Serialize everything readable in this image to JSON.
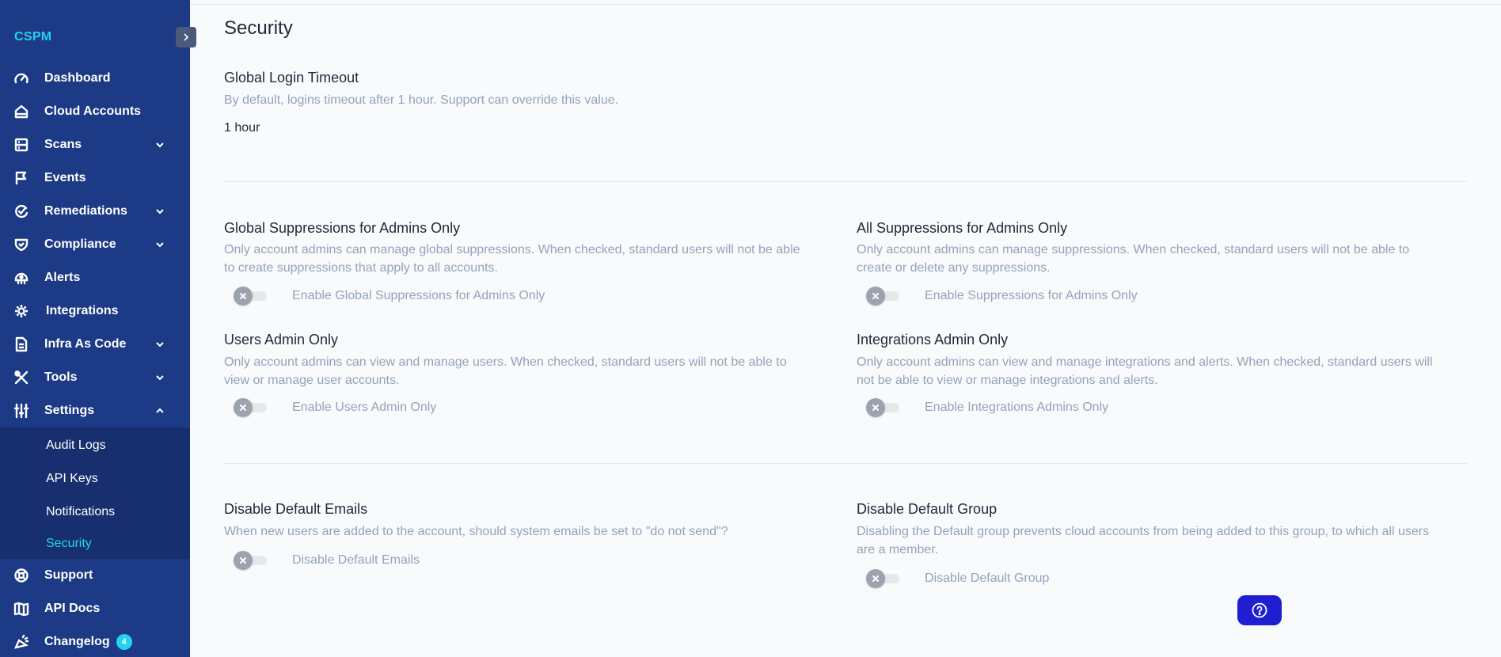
{
  "app": {
    "brand": "CSPM"
  },
  "sidebar": {
    "items": [
      {
        "label": "Dashboard",
        "icon": "gauge-icon"
      },
      {
        "label": "Cloud Accounts",
        "icon": "cloud-account-icon"
      },
      {
        "label": "Scans",
        "icon": "server-icon",
        "expandable": true
      },
      {
        "label": "Events",
        "icon": "flag-icon"
      },
      {
        "label": "Remediations",
        "icon": "remediation-icon",
        "expandable": true
      },
      {
        "label": "Compliance",
        "icon": "shield-check-icon",
        "expandable": true
      },
      {
        "label": "Alerts",
        "icon": "alert-icon"
      },
      {
        "label": "Integrations",
        "icon": "integrations-icon"
      },
      {
        "label": "Infra As Code",
        "icon": "document-icon",
        "expandable": true
      },
      {
        "label": "Tools",
        "icon": "tools-icon",
        "expandable": true
      },
      {
        "label": "Settings",
        "icon": "sliders-icon",
        "expandable": true,
        "expanded": true
      }
    ],
    "settings_sub": [
      "Audit Logs",
      "API Keys",
      "Notifications",
      "Security"
    ],
    "active_sub": "Security",
    "bottom_items": [
      {
        "label": "Support",
        "icon": "lifebuoy-icon"
      },
      {
        "label": "API Docs",
        "icon": "book-icon"
      },
      {
        "label": "Changelog",
        "icon": "changelog-icon",
        "badge": "4"
      }
    ]
  },
  "page": {
    "title": "Security",
    "login_timeout": {
      "title": "Global Login Timeout",
      "desc": "By default, logins timeout after 1 hour. Support can override this value.",
      "value": "1 hour"
    },
    "global_suppressions": {
      "title": "Global Suppressions for Admins Only",
      "desc1": "Only account admins can manage global suppressions. When checked, standard users will not be able",
      "desc2": "to create suppressions that apply to all accounts.",
      "toggle_label": "Enable Global Suppressions for Admins Only",
      "enabled": false
    },
    "all_suppressions": {
      "title": "All Suppressions for Admins Only",
      "desc1": "Only account admins can manage suppressions. When checked, standard users will not be able to",
      "desc2": "create or delete any suppressions.",
      "toggle_label": "Enable Suppressions for Admins Only",
      "enabled": false
    },
    "users_admin": {
      "title": "Users Admin Only",
      "desc1": "Only account admins can view and manage users. When checked, standard users will not be able to",
      "desc2": "view or manage user accounts.",
      "toggle_label": "Enable Users Admin Only",
      "enabled": false
    },
    "integrations_admin": {
      "title": "Integrations Admin Only",
      "desc1": "Only account admins can view and manage integrations and alerts. When checked, standard users will",
      "desc2": "not be able to view or manage integrations and alerts.",
      "toggle_label": "Enable Integrations Admins Only",
      "enabled": false
    },
    "default_emails": {
      "title": "Disable Default Emails",
      "desc1": "When new users are added to the account, should system emails be set to \"do not send\"?",
      "toggle_label": "Disable Default Emails",
      "enabled": false
    },
    "default_group": {
      "title": "Disable Default Group",
      "desc1": "Disabling the Default group prevents cloud accounts from being added to this group, to which all users",
      "desc2": "are a member.",
      "toggle_label": "Disable Default Group",
      "enabled": false
    }
  },
  "colors": {
    "sidebar": "#1c3a85",
    "accent": "#22d3ee",
    "help": "#1f1fd1"
  }
}
